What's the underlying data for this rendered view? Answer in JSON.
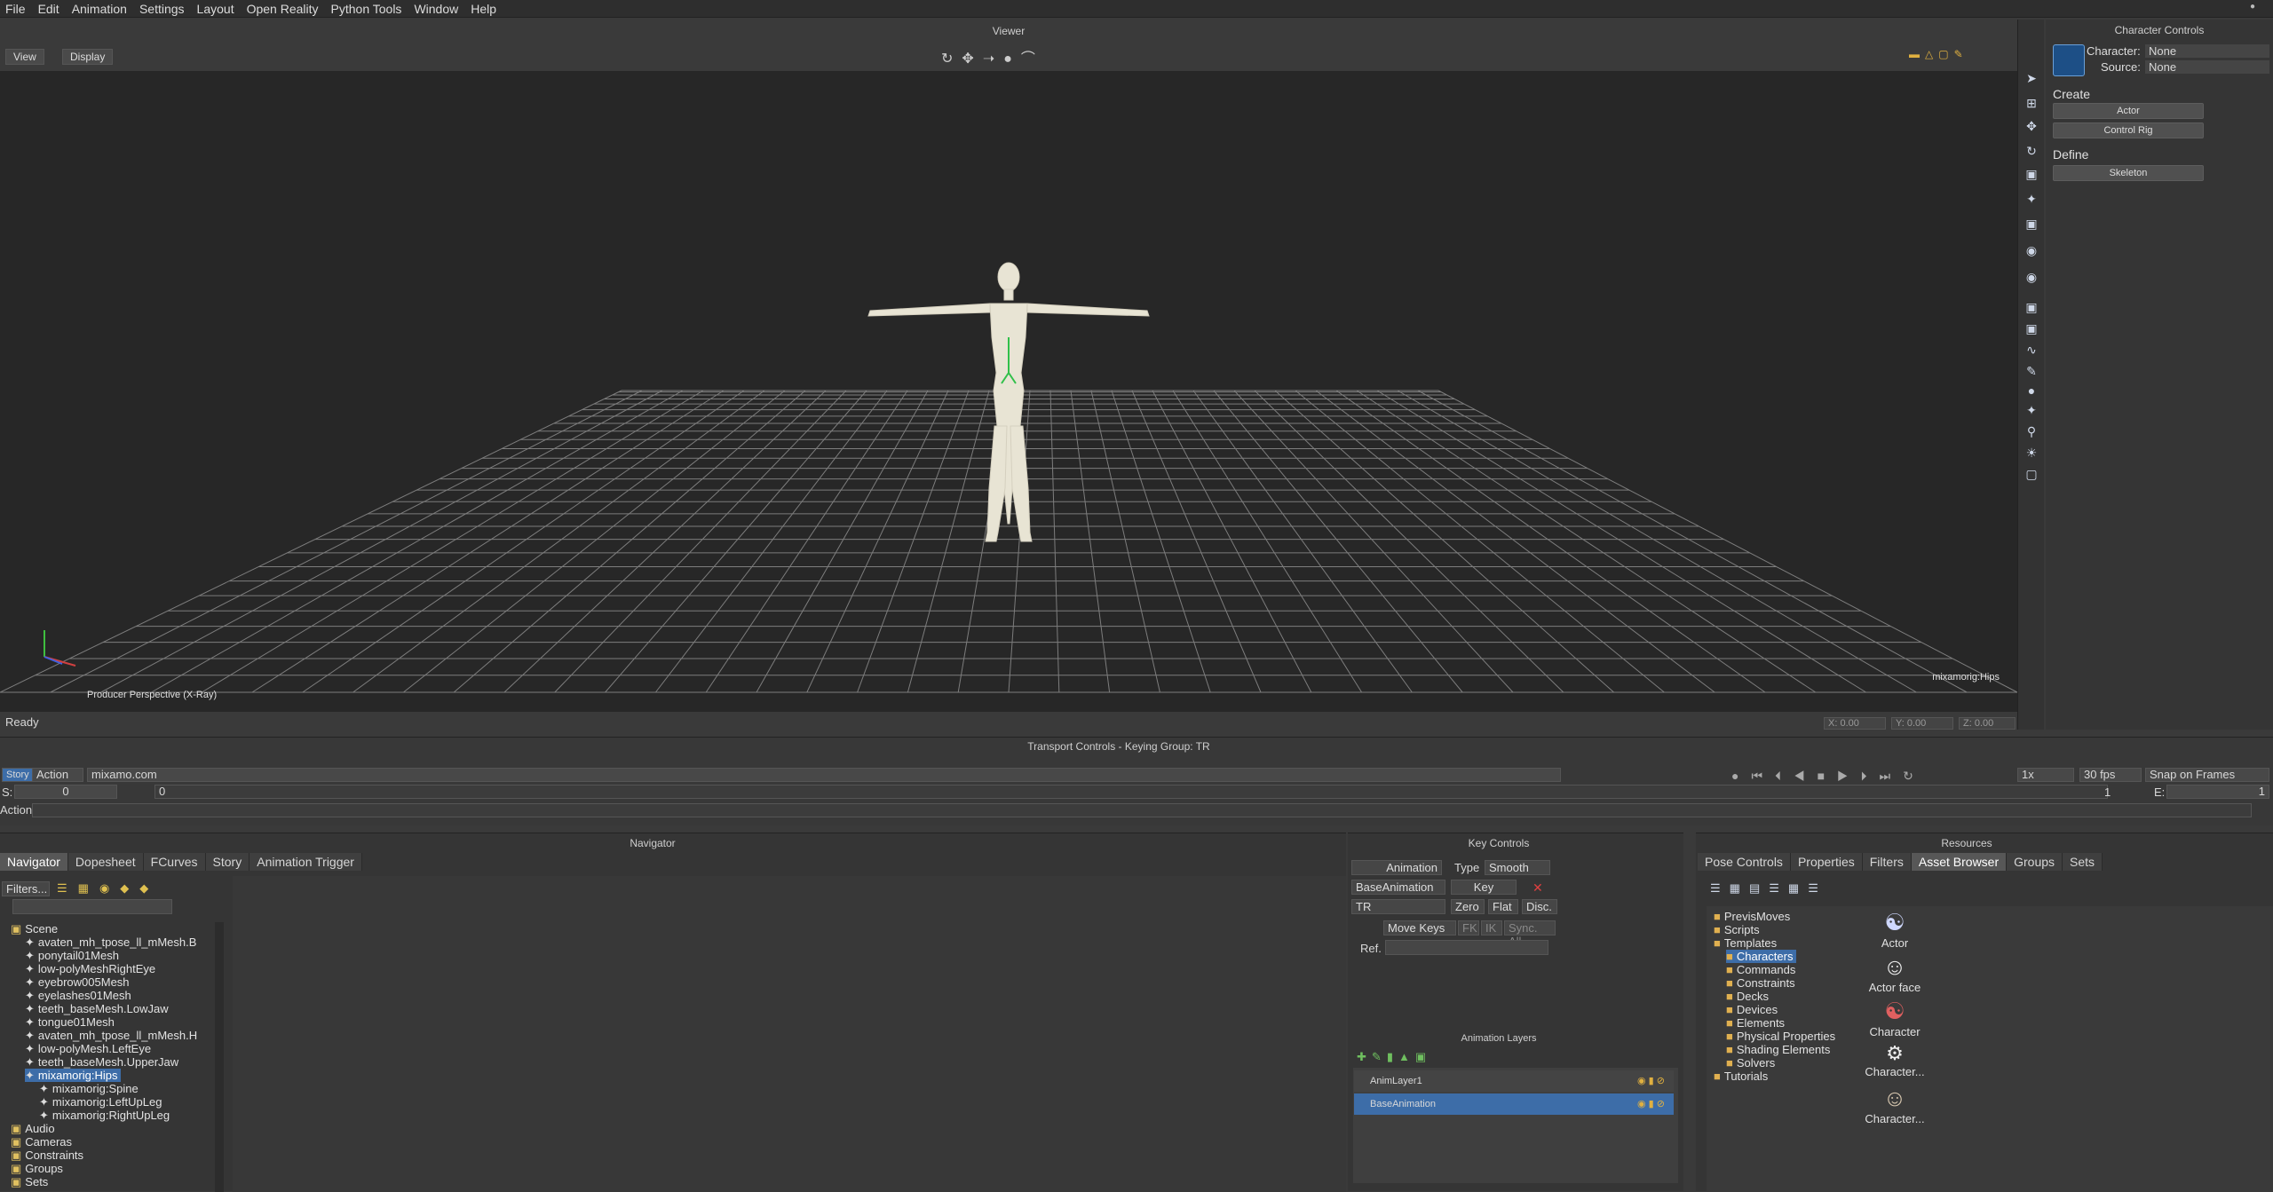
{
  "menu": [
    "File",
    "Edit",
    "Animation",
    "Settings",
    "Layout",
    "Open Reality",
    "Python Tools",
    "Window",
    "Help"
  ],
  "viewer": {
    "title": "Viewer",
    "view_btn": "View",
    "display_btn": "Display",
    "camera_label": "Producer Perspective (X-Ray)",
    "selection_label": "mixamorig:Hips",
    "status": "Ready",
    "coords": [
      "X: 0.00",
      "Y: 0.00",
      "Z: 0.00"
    ]
  },
  "character_controls": {
    "title": "Character Controls",
    "character_label": "Character:",
    "character_value": "None",
    "source_label": "Source:",
    "source_value": "None",
    "create_label": "Create",
    "actor_btn": "Actor",
    "control_rig_btn": "Control Rig",
    "define_label": "Define",
    "skeleton_btn": "Skeleton"
  },
  "transport": {
    "title": "Transport Controls  -  Keying Group: TR",
    "story_btn": "Story",
    "action_dropdown": "Action",
    "take_name": "mixamo.com",
    "speed": "1x",
    "fps": "30 fps",
    "snap": "Snap on Frames",
    "start_label": "S:",
    "start_value": "0",
    "current_value": "0",
    "frame_value": "1",
    "end_label": "E:",
    "end_value": "1",
    "action_row_label": "Action"
  },
  "navigator": {
    "title": "Navigator",
    "tabs": [
      "Navigator",
      "Dopesheet",
      "FCurves",
      "Story",
      "Animation Trigger"
    ],
    "filters_label": "Filters...",
    "tree": [
      {
        "label": "Scene",
        "indent": 0
      },
      {
        "label": "avaten_mh_tpose_ll_mMesh.B",
        "indent": 1
      },
      {
        "label": "ponytail01Mesh",
        "indent": 1
      },
      {
        "label": "low-polyMeshRightEye",
        "indent": 1
      },
      {
        "label": "eyebrow005Mesh",
        "indent": 1
      },
      {
        "label": "eyelashes01Mesh",
        "indent": 1
      },
      {
        "label": "teeth_baseMesh.LowJaw",
        "indent": 1
      },
      {
        "label": "tongue01Mesh",
        "indent": 1
      },
      {
        "label": "avaten_mh_tpose_ll_mMesh.H",
        "indent": 1
      },
      {
        "label": "low-polyMesh.LeftEye",
        "indent": 1
      },
      {
        "label": "teeth_baseMesh.UpperJaw",
        "indent": 1
      },
      {
        "label": "mixamorig:Hips",
        "indent": 1,
        "selected": true
      },
      {
        "label": "mixamorig:Spine",
        "indent": 2
      },
      {
        "label": "mixamorig:LeftUpLeg",
        "indent": 2
      },
      {
        "label": "mixamorig:RightUpLeg",
        "indent": 2
      },
      {
        "label": "Audio",
        "indent": 0
      },
      {
        "label": "Cameras",
        "indent": 0
      },
      {
        "label": "Constraints",
        "indent": 0
      },
      {
        "label": "Groups",
        "indent": 0
      },
      {
        "label": "Sets",
        "indent": 0
      }
    ]
  },
  "key_controls": {
    "title": "Key Controls",
    "animation_btn": "Animation",
    "type_label": "Type",
    "type_value": "Smooth",
    "layer_value": "BaseAnimation",
    "key_btn": "Key",
    "group_value": "TR",
    "zero_btn": "Zero",
    "flat_btn": "Flat",
    "disc_btn": "Disc.",
    "move_keys": "Move Keys",
    "fk_btn": "FK",
    "ik_btn": "IK",
    "sync_btn": "Sync. All",
    "ref_label": "Ref."
  },
  "anim_layers": {
    "title": "Animation Layers",
    "layers": [
      "AnimLayer1",
      "BaseAnimation"
    ]
  },
  "resources": {
    "title": "Resources",
    "tabs": [
      "Pose Controls",
      "Properties",
      "Filters",
      "Asset Browser",
      "Groups",
      "Sets"
    ],
    "active_tab": "Asset Browser",
    "folders": [
      {
        "label": "PrevisMoves",
        "indent": 0
      },
      {
        "label": "Scripts",
        "indent": 0
      },
      {
        "label": "Templates",
        "indent": 0
      },
      {
        "label": "Characters",
        "indent": 1,
        "selected": true
      },
      {
        "label": "Commands",
        "indent": 1
      },
      {
        "label": "Constraints",
        "indent": 1
      },
      {
        "label": "Decks",
        "indent": 1
      },
      {
        "label": "Devices",
        "indent": 1
      },
      {
        "label": "Elements",
        "indent": 1
      },
      {
        "label": "Physical Properties",
        "indent": 1
      },
      {
        "label": "Shading Elements",
        "indent": 1
      },
      {
        "label": "Solvers",
        "indent": 1
      },
      {
        "label": "Tutorials",
        "indent": 0
      }
    ],
    "assets": [
      "Actor",
      "Actor face",
      "Character",
      "Character...",
      "Character..."
    ]
  },
  "colors": {
    "selection": "#3d6da8",
    "viewport_bg": "#272727",
    "grid": "#8a8a8a",
    "figure": "#e8e4d4"
  }
}
